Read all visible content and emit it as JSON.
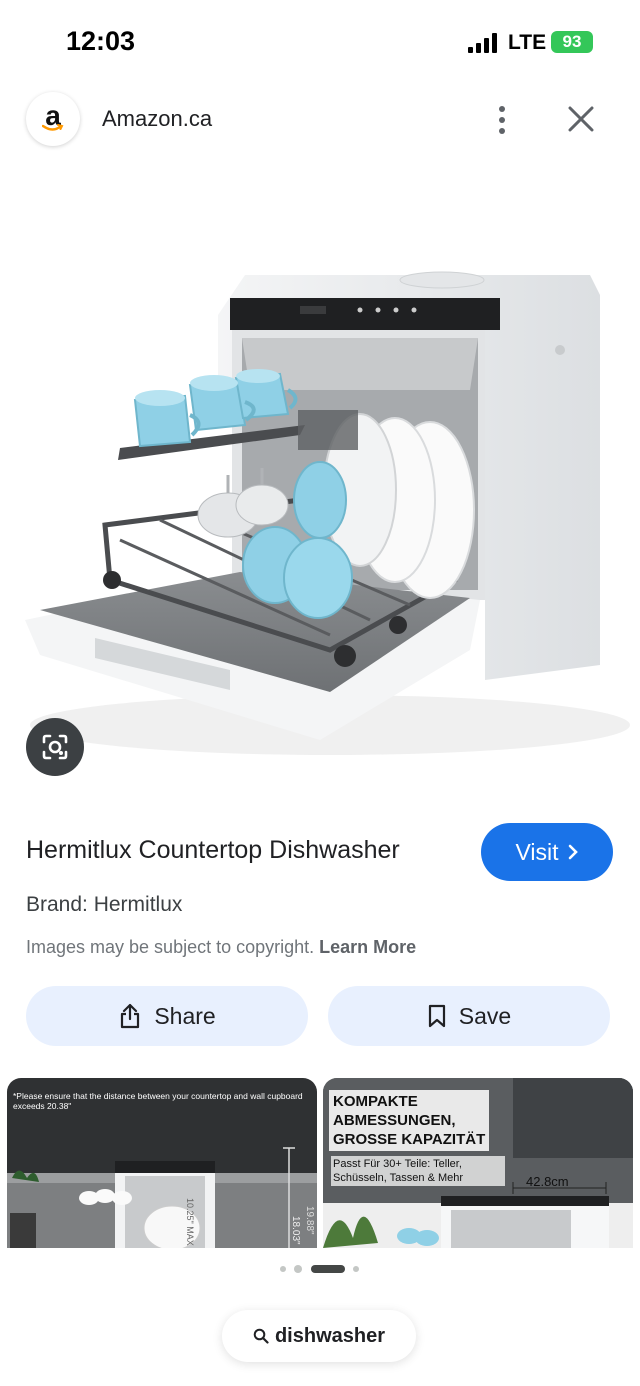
{
  "status_bar": {
    "time": "12:03",
    "network": "LTE",
    "battery": "93"
  },
  "header": {
    "site_name": "Amazon.ca",
    "logo_letter": "a",
    "menu_icon": "more-vert-icon",
    "close_icon": "close-icon"
  },
  "product": {
    "title": "Hermitlux Countertop Dishwasher",
    "visit_label": "Visit",
    "brand": "Brand: Hermitlux",
    "copyright_text": "Images may be subject to copyright.",
    "learn_more": "Learn More"
  },
  "actions": {
    "share_label": "Share",
    "save_label": "Save"
  },
  "thumbnails": [
    {
      "caption": "*Please ensure that the distance between your countertop and wall cupboard exceeds 20.38\"",
      "dims": [
        "19.88\"",
        "18.03\"",
        "10.25\" MAX"
      ]
    },
    {
      "title": "KOMPAKTE\nABMESSUNGEN,\nGROSSE KAPAZITÄT",
      "subtitle": "Passt Für 30+ Teile: Teller, Schüsseln, Tassen & Mehr",
      "dimension": "42.8cm"
    }
  ],
  "pager": {
    "total": 4,
    "active": 2
  },
  "search": {
    "query": "dishwasher",
    "icon": "search-icon"
  },
  "colors": {
    "accent": "#1a73e8",
    "pill": "#e8f0fe",
    "battery": "#34c759",
    "cup": "#8fd0e6"
  }
}
